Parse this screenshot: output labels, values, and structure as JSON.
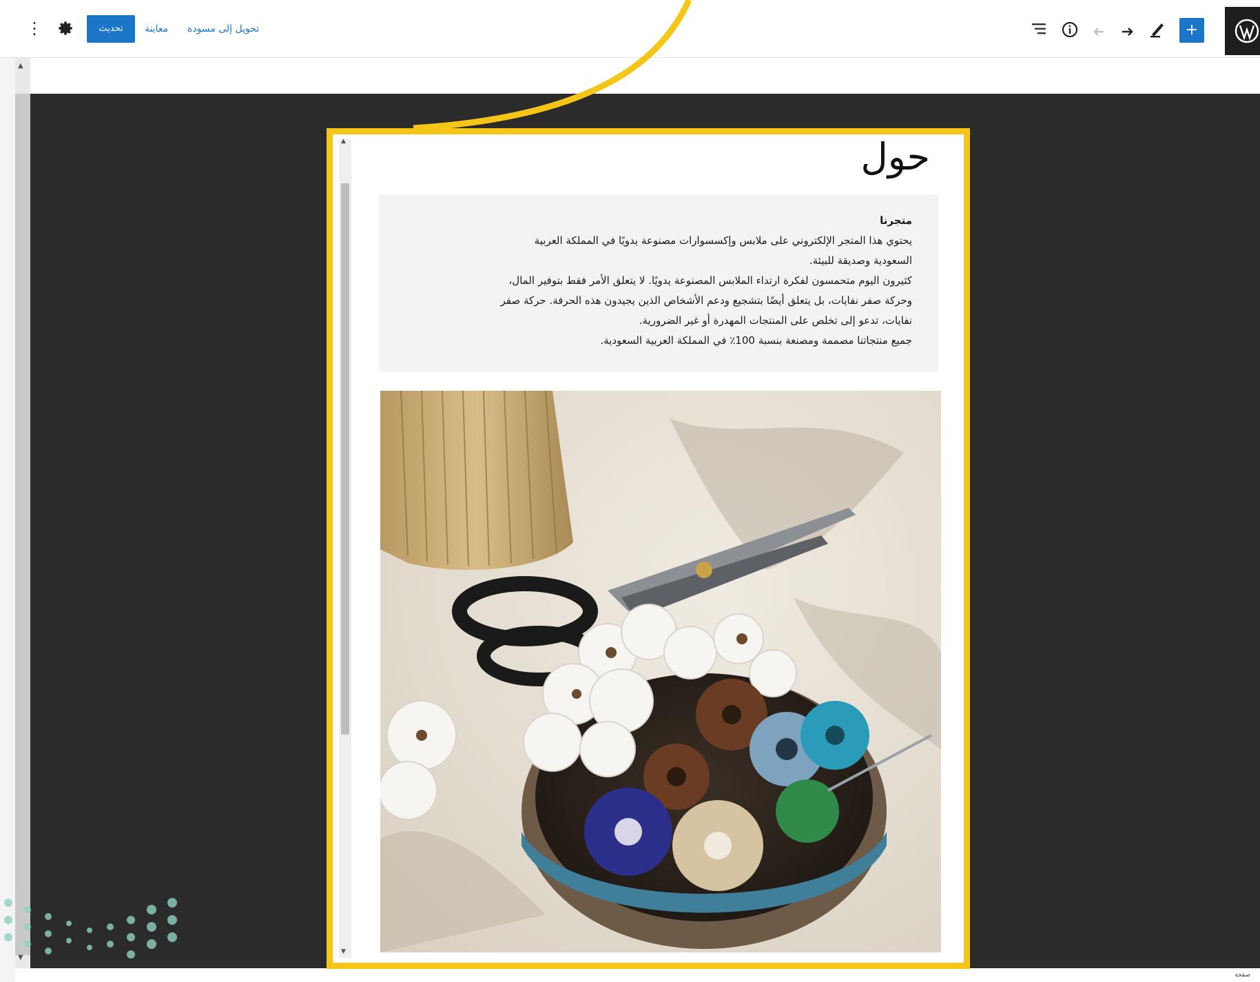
{
  "toolbar": {
    "update_label": "تحديث",
    "preview_label": "معاينة",
    "draft_label": "تحويل إلى مسودة",
    "add_label": "+",
    "more_label": "⋮"
  },
  "page": {
    "title": "حول",
    "heading": "متجرنا",
    "lines": [
      "يحتوي هذا المتجر الإلكتروني على ملابس وإكسسوارات مصنوعة يدويًا في المملكة العربية",
      "السعودية وصديقة للبيئة.",
      "كثيرون اليوم متحمسون لفكرة ارتداء الملابس المصنوعة يدويًا. لا يتعلق الأمر فقط بتوفير المال،",
      "وحركة صفر نفايات، بل يتعلق أيضًا بتشجيع ودعم الأشخاص الذين يجيدون هذه الحرفة. حركة صفر",
      "نفايات، تدعو إلى تخلص على المنتجات المهدرة أو غير الضرورية.",
      "جميع منتجاتنا مصممة ومصنعة بنسبة 100٪ في المملكة العربية السعودية."
    ]
  },
  "footer": {
    "label": "صفحة"
  },
  "colors": {
    "accent": "#1b76c8",
    "highlight": "#f5c518",
    "canvas": "#2b2b2b"
  },
  "icons": {
    "wordpress": "wordpress-logo-icon",
    "settings": "gear-icon",
    "list_view": "list-view-icon",
    "details": "info-icon",
    "undo": "undo-icon",
    "redo": "redo-icon",
    "tools": "pen-icon"
  }
}
